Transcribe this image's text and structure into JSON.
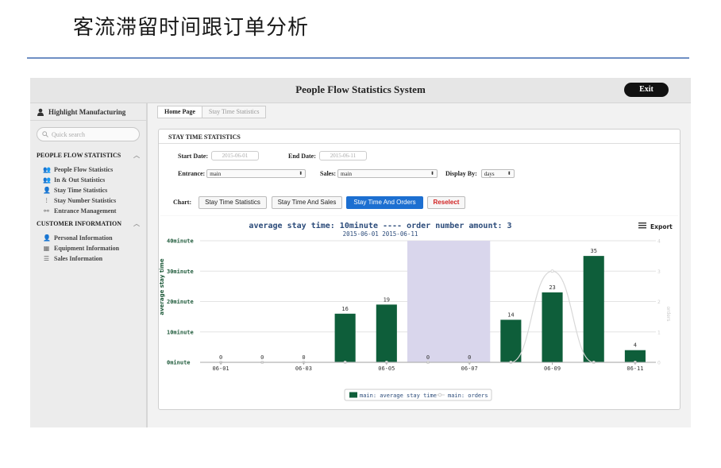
{
  "slide": {
    "title": "客流滞留时间跟订单分析"
  },
  "app": {
    "title": "People Flow Statistics System",
    "exit_label": "Exit"
  },
  "sidebar": {
    "user": "Highlight Manufacturing",
    "search_placeholder": "Quick search",
    "sections": [
      {
        "title": "PEOPLE FLOW STATISTICS",
        "items": [
          {
            "label": "People Flow Statistics",
            "icon": "people-icon"
          },
          {
            "label": "In & Out Statistics",
            "icon": "people-icon"
          },
          {
            "label": "Stay Time Statistics",
            "icon": "person-icon"
          },
          {
            "label": "Stay Number Statistics",
            "icon": "sliders-icon"
          },
          {
            "label": "Entrance Management",
            "icon": "network-icon"
          }
        ]
      },
      {
        "title": "CUSTOMER INFORMATION",
        "items": [
          {
            "label": "Personal Information",
            "icon": "person-icon"
          },
          {
            "label": "Equipment Information",
            "icon": "equipment-icon"
          },
          {
            "label": "Sales Information",
            "icon": "list-icon"
          }
        ]
      }
    ]
  },
  "breadcrumb": {
    "home": "Home Page",
    "current": "Stay Time Statistics"
  },
  "panel": {
    "title": "STAY TIME STATISTICS",
    "start_label": "Start Date:",
    "start_value": "2015-06-01",
    "end_label": "End Date:",
    "end_value": "2015-06-11",
    "entrance_label": "Entrance:",
    "entrance_value": "main",
    "sales_label": "Sales:",
    "sales_value": "main",
    "display_label": "Display By:",
    "display_value": "days",
    "chart_label": "Chart:",
    "buttons": [
      "Stay Time Statistics",
      "Stay Time And Sales",
      "Stay Time And Orders",
      "Reselect"
    ],
    "export_label": "Export"
  },
  "chart_data": {
    "type": "bar",
    "title": "average stay time: 10minute ---- order number amount: 3",
    "subtitle": "2015-06-01 2015-06-11",
    "xlabel": "",
    "ylabel": "average stay time",
    "y2label": "orders",
    "x_tick_labels": [
      "06-01",
      "06-03",
      "06-05",
      "06-07",
      "06-09",
      "06-11"
    ],
    "categories": [
      "06-01",
      "06-02",
      "06-03",
      "06-04",
      "06-05",
      "06-06",
      "06-07",
      "06-08",
      "06-09",
      "06-10",
      "06-11"
    ],
    "ylim": [
      0,
      40
    ],
    "yticks": [
      "0minute",
      "10minute",
      "20minute",
      "30minute",
      "40minute"
    ],
    "y2lim": [
      0,
      4
    ],
    "y2ticks": [
      "0",
      "1",
      "2",
      "3",
      "4"
    ],
    "highlight_range": [
      "06-06",
      "06-07"
    ],
    "series": [
      {
        "name": "main: average stay time",
        "type": "bar",
        "color": "#0e5e3a",
        "values": [
          0,
          0,
          0,
          16,
          19,
          0,
          0,
          14,
          23,
          35,
          4
        ]
      },
      {
        "name": "main: orders",
        "type": "line",
        "color": "#d8d8d8",
        "values": [
          0,
          0,
          0,
          0,
          0,
          0,
          0,
          0,
          3,
          0,
          0
        ]
      }
    ],
    "legend_position": "bottom-center"
  }
}
